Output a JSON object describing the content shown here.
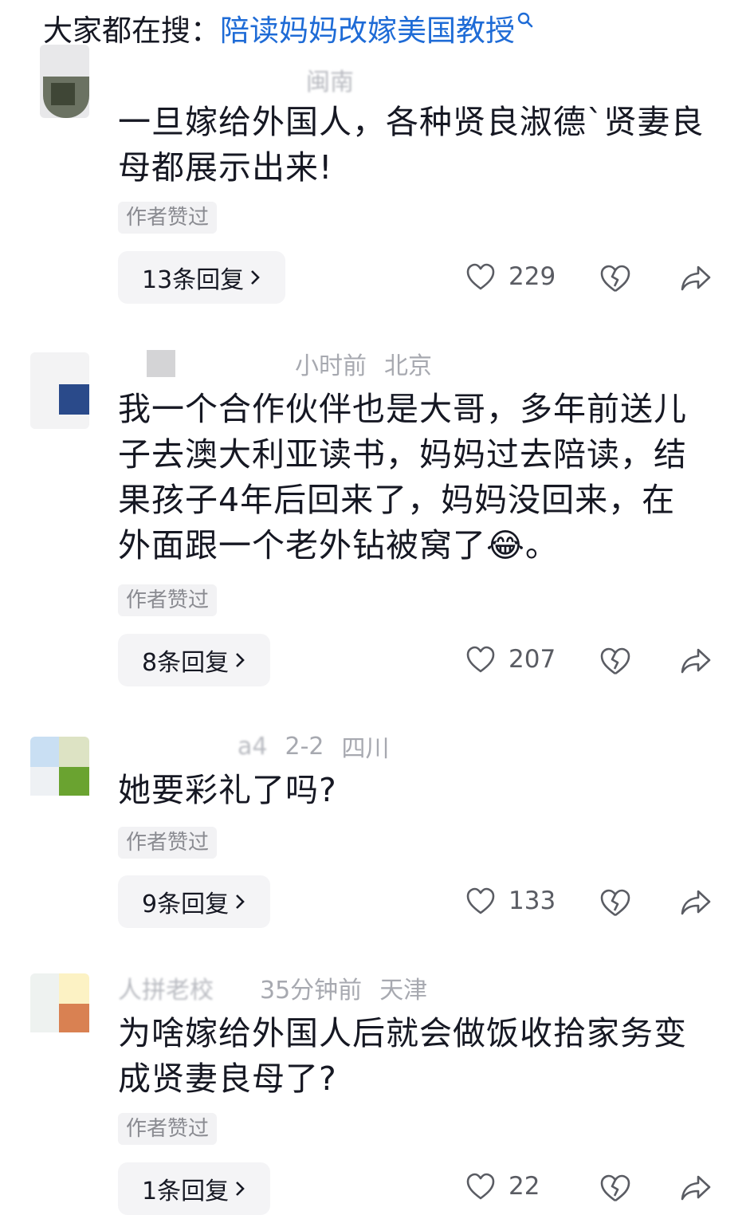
{
  "search": {
    "prefix": "大家都在搜：",
    "query": "陪读妈妈改嫁美国教授"
  },
  "comments": [
    {
      "name": "闽南",
      "time": "",
      "location": "",
      "text": "一旦嫁给外国人，各种贤良淑德`贤妻良母都展示出来!",
      "author_liked": "作者赞过",
      "replies": "13条回复",
      "likes": "229"
    },
    {
      "name": "",
      "time": "小时前",
      "location": "北京",
      "text": "我一个合作伙伴也是大哥，多年前送儿子去澳大利亚读书，妈妈过去陪读，结果孩子4年后回来了，妈妈没回来，在外面跟一个老外钻被窝了😂。",
      "author_liked": "作者赞过",
      "replies": "8条回复",
      "likes": "207"
    },
    {
      "name": "a4",
      "time": "2-2",
      "location": "四川",
      "text": "她要彩礼了吗?",
      "author_liked": "作者赞过",
      "replies": "9条回复",
      "likes": "133"
    },
    {
      "name": "人拼老校",
      "time": "35分钟前",
      "location": "天津",
      "text": "为啥嫁给外国人后就会做饭收拾家务变成贤妻良母了?",
      "author_liked": "作者赞过",
      "replies": "1条回复",
      "likes": "22"
    }
  ],
  "icons": {
    "search": "search-icon",
    "like": "heart-icon",
    "dislike": "broken-heart-icon",
    "share": "share-icon",
    "chevron": "chevron-right-icon"
  },
  "colors": {
    "link": "#1e6bd6",
    "text": "#161823",
    "meta": "#a7a9b0"
  }
}
